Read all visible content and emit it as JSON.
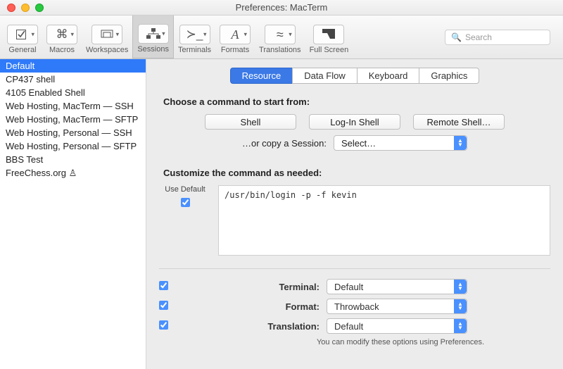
{
  "window": {
    "title": "Preferences: MacTerm"
  },
  "search": {
    "placeholder": "Search"
  },
  "toolbar": {
    "items": [
      {
        "label": "General"
      },
      {
        "label": "Macros"
      },
      {
        "label": "Workspaces"
      },
      {
        "label": "Sessions"
      },
      {
        "label": "Terminals"
      },
      {
        "label": "Formats"
      },
      {
        "label": "Translations"
      },
      {
        "label": "Full Screen"
      }
    ]
  },
  "sidebar": {
    "items": [
      "Default",
      "CP437 shell",
      "4105 Enabled Shell",
      "Web Hosting, MacTerm — SSH",
      "Web Hosting, MacTerm — SFTP",
      "Web Hosting, Personal — SSH",
      "Web Hosting, Personal — SFTP",
      "BBS Test",
      "FreeChess.org ♙"
    ]
  },
  "tabs": {
    "resource": "Resource",
    "dataflow": "Data Flow",
    "keyboard": "Keyboard",
    "graphics": "Graphics"
  },
  "resource": {
    "choose_label": "Choose a command to start from:",
    "shell_btn": "Shell",
    "login_btn": "Log-In Shell",
    "remote_btn": "Remote Shell…",
    "copy_label": "…or copy a Session:",
    "copy_select": "Select…",
    "customize_label": "Customize the command as needed:",
    "use_default_label": "Use Default",
    "command": "/usr/bin/login -p -f kevin",
    "terminal_label": "Terminal:",
    "terminal_value": "Default",
    "format_label": "Format:",
    "format_value": "Throwback",
    "translation_label": "Translation:",
    "translation_value": "Default",
    "hint": "You can modify these options using Preferences."
  }
}
